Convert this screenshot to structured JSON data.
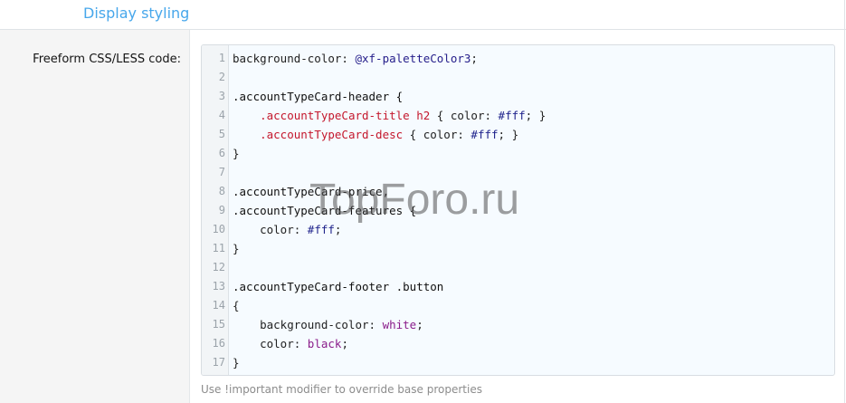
{
  "section": {
    "title": "Display styling"
  },
  "field": {
    "label": "Freeform CSS/LESS code:",
    "hint": "Use !important modifier to override base properties"
  },
  "editor": {
    "lines": [
      {
        "n": "1",
        "tokens": [
          [
            "prop",
            "background-color: "
          ],
          [
            "var",
            "@xf-paletteColor3"
          ],
          [
            "plain",
            ";"
          ]
        ]
      },
      {
        "n": "2",
        "tokens": []
      },
      {
        "n": "3",
        "tokens": [
          [
            "sel",
            ".accountTypeCard-header {"
          ]
        ]
      },
      {
        "n": "4",
        "tokens": [
          [
            "plain",
            "    "
          ],
          [
            "cls",
            ".accountTypeCard-title"
          ],
          [
            "plain",
            " "
          ],
          [
            "tag",
            "h2"
          ],
          [
            "plain",
            " { color: "
          ],
          [
            "hex",
            "#fff"
          ],
          [
            "plain",
            "; }"
          ]
        ]
      },
      {
        "n": "5",
        "tokens": [
          [
            "plain",
            "    "
          ],
          [
            "cls",
            ".accountTypeCard-desc"
          ],
          [
            "plain",
            " { color: "
          ],
          [
            "hex",
            "#fff"
          ],
          [
            "plain",
            "; }"
          ]
        ]
      },
      {
        "n": "6",
        "tokens": [
          [
            "plain",
            "}"
          ]
        ]
      },
      {
        "n": "7",
        "tokens": []
      },
      {
        "n": "8",
        "tokens": [
          [
            "sel",
            ".accountTypeCard-price,"
          ]
        ]
      },
      {
        "n": "9",
        "tokens": [
          [
            "sel",
            ".accountTypeCard-features {"
          ]
        ]
      },
      {
        "n": "10",
        "tokens": [
          [
            "plain",
            "    color: "
          ],
          [
            "hex",
            "#fff"
          ],
          [
            "plain",
            ";"
          ]
        ]
      },
      {
        "n": "11",
        "tokens": [
          [
            "plain",
            "}"
          ]
        ]
      },
      {
        "n": "12",
        "tokens": []
      },
      {
        "n": "13",
        "tokens": [
          [
            "sel",
            ".accountTypeCard-footer .button"
          ]
        ]
      },
      {
        "n": "14",
        "tokens": [
          [
            "plain",
            "{"
          ]
        ]
      },
      {
        "n": "15",
        "tokens": [
          [
            "plain",
            "    background-color: "
          ],
          [
            "kw",
            "white"
          ],
          [
            "plain",
            ";"
          ]
        ]
      },
      {
        "n": "16",
        "tokens": [
          [
            "plain",
            "    color: "
          ],
          [
            "kw",
            "black"
          ],
          [
            "plain",
            ";"
          ]
        ]
      },
      {
        "n": "17",
        "tokens": [
          [
            "plain",
            "}"
          ]
        ]
      }
    ]
  },
  "watermark": "TopForo.ru",
  "colors": {
    "accent": "#47a7eb",
    "editor_bg": "#f6fbff",
    "class_token": "#c4172c",
    "value_token": "#20248c",
    "keyword_token": "#8a1d8a"
  }
}
